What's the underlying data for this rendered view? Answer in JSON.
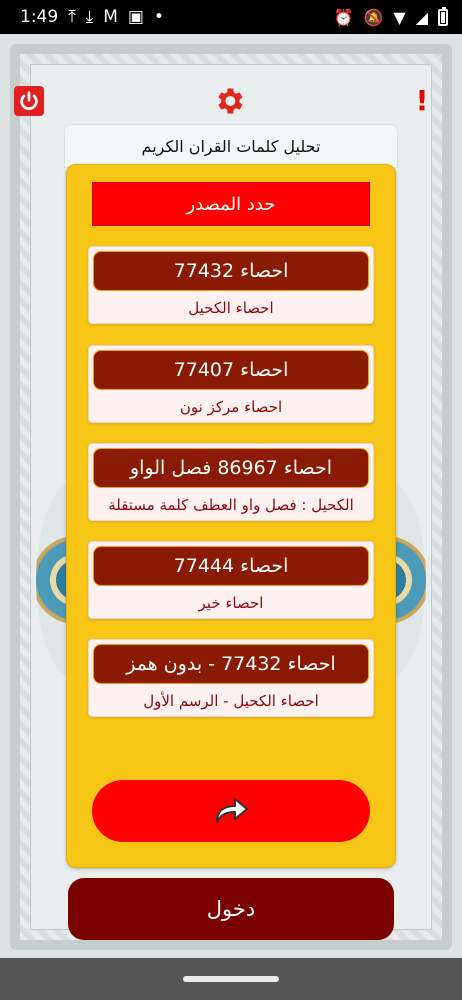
{
  "status_bar": {
    "time": "1:49"
  },
  "app": {
    "title": "تحليل كلمات القران الكريم",
    "source_button": "حدد المصدر",
    "options": [
      {
        "button": "احصاء 77432",
        "subtitle": "احصاء الكحيل"
      },
      {
        "button": "احصاء 77407",
        "subtitle": "احصاء مركز نون"
      },
      {
        "button": "احصاء 86967 فصل الواو",
        "subtitle": "الكحيل : فصل واو العطف كلمة مستقلة"
      },
      {
        "button": "احصاء 77444",
        "subtitle": "احصاء خير"
      },
      {
        "button": "احصاء 77432 - بدون همز",
        "subtitle": "احصاء الكحيل - الرسم الأول"
      }
    ],
    "enter_button": "دخول"
  },
  "icons": {
    "power": "power-icon",
    "settings": "gear-icon",
    "info": "alert-icon",
    "next": "redo-arrow-icon"
  },
  "colors": {
    "panel": "#f6c516",
    "source_button": "#ff0000",
    "option_button": "#8b1a04",
    "enter_button": "#7a0000"
  }
}
